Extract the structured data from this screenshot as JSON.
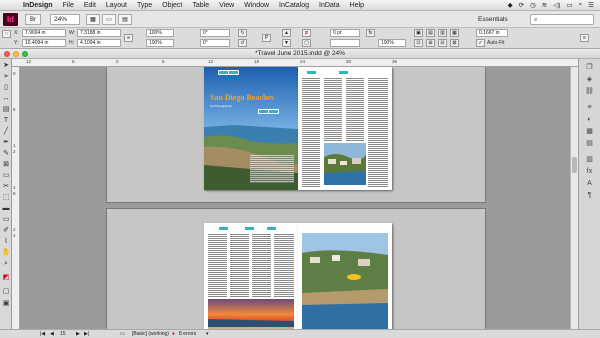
{
  "menubar": {
    "apple": "",
    "items": [
      "InDesign",
      "File",
      "Edit",
      "Layout",
      "Type",
      "Object",
      "Table",
      "View",
      "Window",
      "InCatalog",
      "InData",
      "Help"
    ]
  },
  "appbar": {
    "logo": "Id",
    "bridge": "Br",
    "zoom": "24%",
    "workspace": "Essentials",
    "search_placeholder": ""
  },
  "control": {
    "x_label": "X:",
    "x_value": "7.9694 in",
    "y_label": "Y:",
    "y_value": "10.4094 in",
    "w_label": "W:",
    "w_value": "7.3188 in",
    "h_label": "H:",
    "h_value": "4.1094 in",
    "scale_x": "100%",
    "scale_y": "100%",
    "rotate": "0°",
    "shear": "0°",
    "stroke_weight": "0 pt",
    "opacity": "100%",
    "offset": "0.1667 in",
    "autofit": "Auto-Fit"
  },
  "document": {
    "title": "*Travel June 2015.indd @ 24%",
    "spread1_headline": "San Diego Beaches",
    "spread1_byline": "by Photographer"
  },
  "ruler": {
    "h_ticks": [
      "12",
      "6",
      "0",
      "6",
      "12",
      "18",
      "24",
      "30",
      "36"
    ],
    "v_ticks": [
      "0",
      "6",
      "1",
      "2",
      "1",
      "8",
      "2",
      "4"
    ]
  },
  "status": {
    "page_number": "15",
    "style": "[Basic] (working)",
    "errors": "8 errors"
  },
  "colors": {
    "accent": "#2fb5c8",
    "headline": "#f5a623",
    "id_bg": "#49021f",
    "id_fg": "#ff3b8d",
    "error": "#d0021b"
  },
  "icons": {
    "toolbox": [
      "selection-icon",
      "direct-selection-icon",
      "page-icon",
      "gap-icon",
      "content-collector-icon",
      "type-icon",
      "line-icon",
      "pen-icon",
      "pencil-icon",
      "rectangle-frame-icon",
      "rectangle-icon",
      "scissors-icon",
      "free-transform-icon",
      "gradient-swatch-icon",
      "gradient-feather-icon",
      "note-icon",
      "eyedropper-icon",
      "hand-icon",
      "zoom-icon",
      "fill-stroke-icon"
    ],
    "panels": [
      "pages-icon",
      "layers-icon",
      "links-icon",
      "stroke-icon",
      "color-icon",
      "swatches-icon",
      "cc-libraries-icon",
      "text-wrap-icon",
      "effects-icon",
      "character-styles-icon",
      "paragraph-styles-icon"
    ]
  }
}
